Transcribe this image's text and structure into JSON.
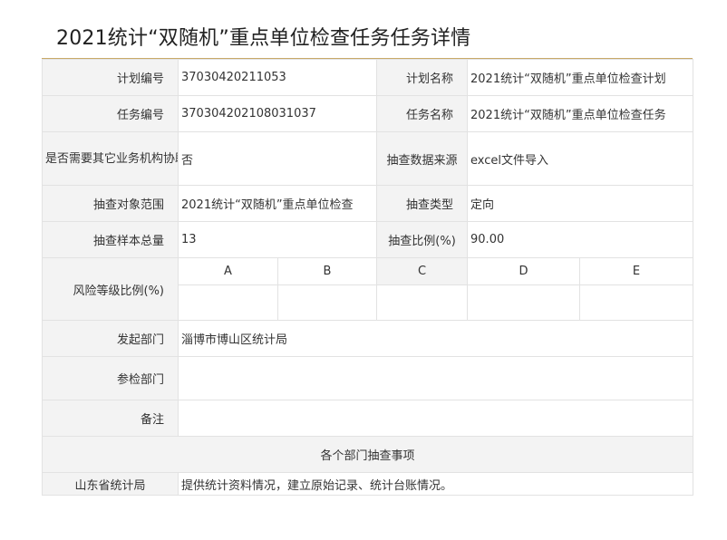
{
  "page": {
    "title": "2021统计“双随机”重点单位检查任务任务详情"
  },
  "fields": {
    "plan_no_label": "计划编号",
    "plan_no": "37030420211053",
    "plan_name_label": "计划名称",
    "plan_name": "2021统计“双随机”重点单位检查计划",
    "task_no_label": "任务编号",
    "task_no": "370304202108031037",
    "task_name_label": "任务名称",
    "task_name": "2021统计“双随机”重点单位检查任务",
    "assist_label": "是否需要其它业务机构协助",
    "assist": "否",
    "source_label": "抽查数据来源",
    "source": "excel文件导入",
    "scope_label": "抽查对象范围",
    "scope": "2021统计“双随机”重点单位检查",
    "type_label": "抽查类型",
    "type": "定向",
    "sample_label": "抽查样本总量",
    "sample": "13",
    "ratio_label": "抽查比例(%)",
    "ratio": "90.00",
    "risk_label": "风险等级比例(%)",
    "risk_levels": [
      "A",
      "B",
      "C",
      "D",
      "E"
    ],
    "dept_label": "发起部门",
    "dept": "淄博市博山区统计局",
    "join_dept_label": "参检部门",
    "join_dept": "",
    "remark_label": "备注",
    "remark": ""
  },
  "section": {
    "title": "各个部门抽查事项",
    "rows": [
      {
        "dept": "山东省统计局",
        "item": "提供统计资料情况，建立原始记录、统计台账情况。"
      }
    ]
  }
}
